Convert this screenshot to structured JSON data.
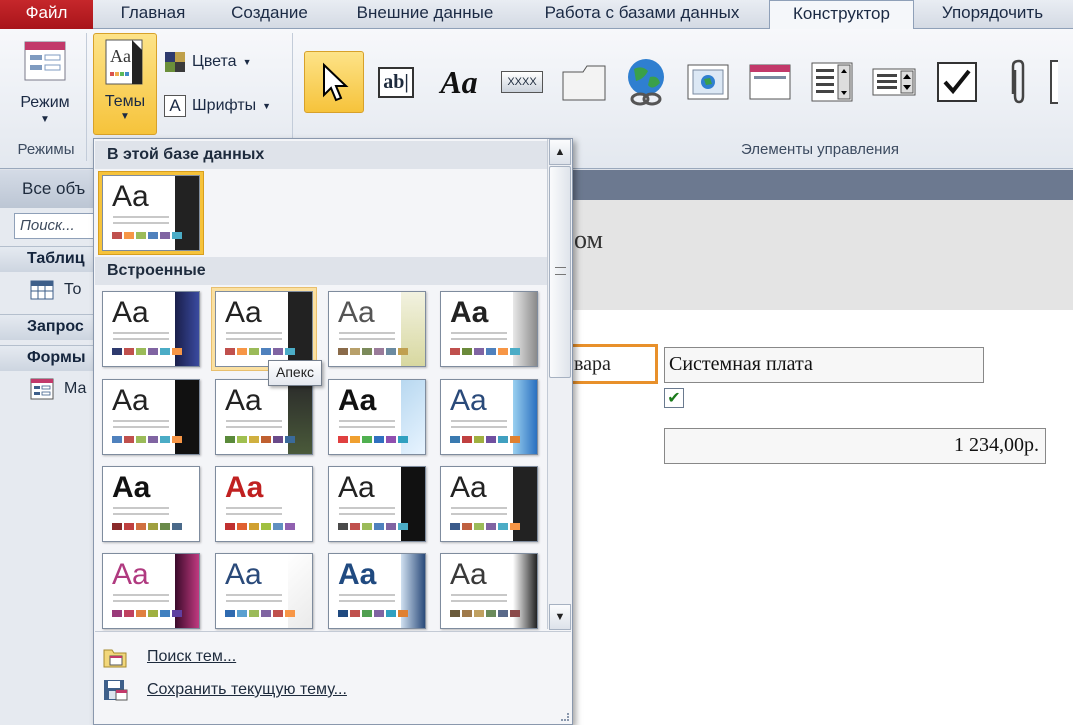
{
  "tabs": [
    {
      "label": "Файл"
    },
    {
      "label": "Главная"
    },
    {
      "label": "Создание"
    },
    {
      "label": "Внешние данные"
    },
    {
      "label": "Работа с базами данных"
    },
    {
      "label": "Конструктор"
    },
    {
      "label": "Упорядочить"
    }
  ],
  "ribbon": {
    "views_button": "Режим",
    "views_group": "Режимы",
    "themes_button": "Темы",
    "colors_button": "Цвета",
    "fonts_button": "Шрифты",
    "controls_group": "Элементы управления",
    "textbox_glyph": "ab|",
    "label_glyph": "Aa",
    "button_glyph": "XXXX"
  },
  "nav": {
    "header": "Все объ",
    "search_placeholder": "Поиск...",
    "sections": [
      "Таблиц",
      "Запрос",
      "Формы"
    ],
    "items": [
      "То",
      "Ма"
    ]
  },
  "form": {
    "title_fragment": "ом",
    "label_fragment": "вара",
    "product_value": "Системная плата",
    "checkbox_checked": true,
    "price_value": "1 234,00р."
  },
  "gallery": {
    "section_current": "В этой базе данных",
    "section_builtin": "Встроенные",
    "aa_text": "Aa",
    "tooltip": "Апекс",
    "footer_search": "Поиск тем...",
    "footer_save": "Сохранить текущую тему..."
  },
  "colors": {
    "accent_selected": "#f6c33b",
    "file_tab": "#b81d22",
    "form_header": "#6c7990",
    "label_border": "#e8902a"
  }
}
